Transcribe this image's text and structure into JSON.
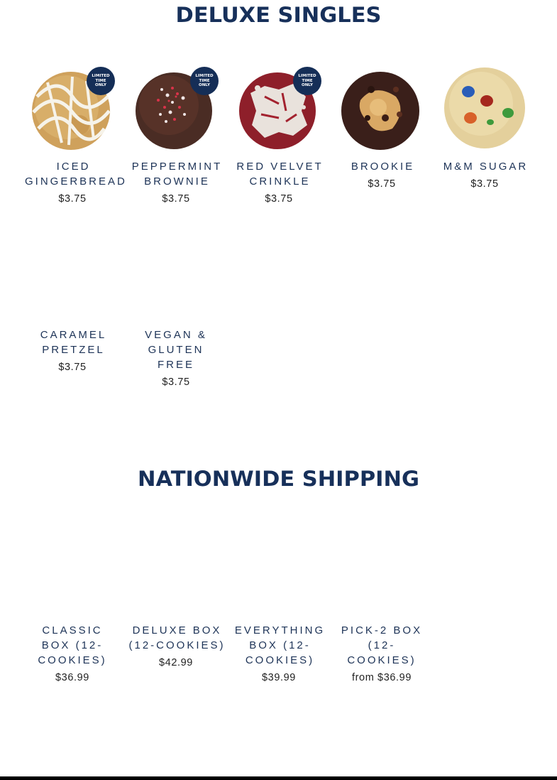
{
  "deluxe_singles": {
    "title": "DELUXE SINGLES",
    "products": [
      {
        "name": "ICED GINGERBREAD",
        "price": "$3.75",
        "badge": [
          "LIMITED",
          "TIME",
          "ONLY"
        ],
        "image": "iced-gingerbread-cookie"
      },
      {
        "name": "PEPPERMINT BROWNIE",
        "price": "$3.75",
        "badge": [
          "LIMITED",
          "TIME",
          "ONLY"
        ],
        "image": "peppermint-brownie-cookie"
      },
      {
        "name": "RED VELVET CRINKLE",
        "price": "$3.75",
        "badge": [
          "LIMITED",
          "TIME",
          "ONLY"
        ],
        "image": "red-velvet-crinkle-cookie"
      },
      {
        "name": "BROOKIE",
        "price": "$3.75",
        "image": "brookie-cookie"
      },
      {
        "name": "M&M SUGAR",
        "price": "$3.75",
        "image": "mm-sugar-cookie"
      },
      {
        "name": "CARAMEL PRETZEL",
        "price": "$3.75"
      },
      {
        "name": "VEGAN & GLUTEN FREE",
        "price": "$3.75"
      }
    ]
  },
  "nationwide_shipping": {
    "title": "NATIONWIDE SHIPPING",
    "products": [
      {
        "name": "CLASSIC BOX (12-COOKIES)",
        "price": "$36.99"
      },
      {
        "name": "DELUXE BOX (12-COOKIES)",
        "price": "$42.99"
      },
      {
        "name": "EVERYTHING BOX (12-COOKIES)",
        "price": "$39.99"
      },
      {
        "name": "PICK-2 BOX (12-COOKIES)",
        "price": "from $36.99"
      }
    ]
  },
  "colors": {
    "heading": "#17305a",
    "product_name": "#1d3357",
    "price": "#222222",
    "badge": "#152e57"
  }
}
